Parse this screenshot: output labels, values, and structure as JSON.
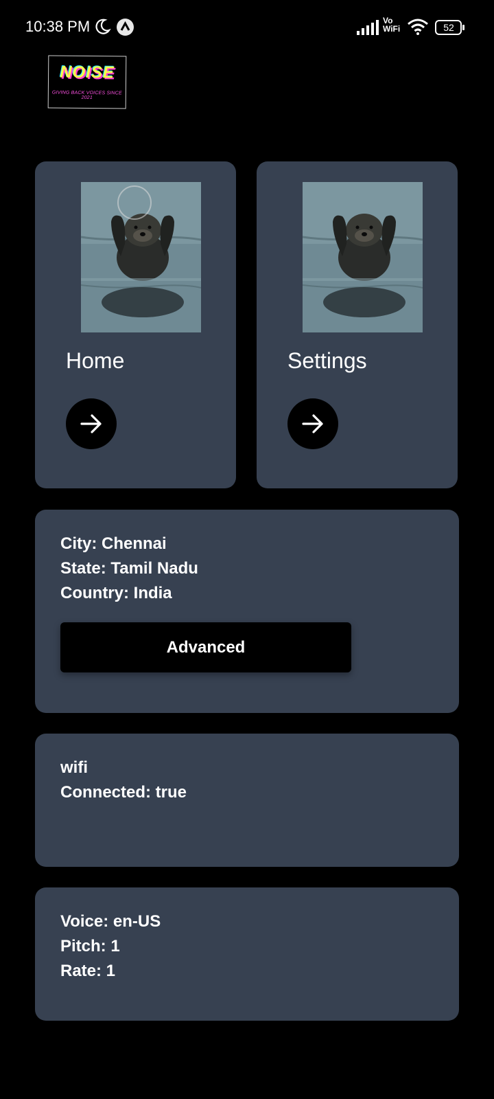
{
  "status_bar": {
    "time": "10:38 PM",
    "network_label_top": "Vo",
    "network_label_bottom": "WiFi",
    "battery_level": "52",
    "icons": [
      "moon-icon",
      "app-badge-icon",
      "signal-icon",
      "wifi-icon",
      "battery-icon"
    ]
  },
  "logo": {
    "title": "NOISE",
    "tagline": "GIVING BACK VOICES SINCE 2021"
  },
  "nav_cards": [
    {
      "label": "Home",
      "image": "sea-otter-photo",
      "action_icon": "arrow-right-icon"
    },
    {
      "label": "Settings",
      "image": "sea-otter-photo",
      "action_icon": "arrow-right-icon"
    }
  ],
  "location": {
    "city": "City: Chennai",
    "state": "State: Tamil Nadu",
    "country": "Country: India",
    "advanced_button": "Advanced"
  },
  "network": {
    "type": "wifi",
    "connected": "Connected: true"
  },
  "voice": {
    "voice": "Voice: en-US",
    "pitch": "Pitch: 1",
    "rate": "Rate: 1"
  },
  "colors": {
    "background": "#000000",
    "card": "#374151",
    "text": "#ffffff",
    "logo_yellow": "#f6ff47",
    "logo_pink": "#ff52e5"
  }
}
